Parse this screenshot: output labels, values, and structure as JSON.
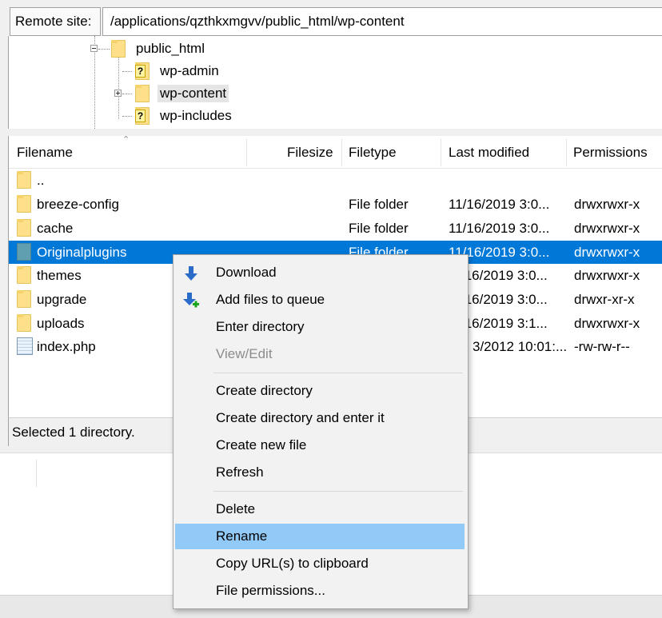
{
  "remote_site": {
    "label": "Remote site:",
    "path": "/applications/qzthkxmgvv/public_html/wp-content"
  },
  "tree": {
    "nodes": [
      {
        "label": "public_html",
        "icon": "folder-icon",
        "expander": "minus"
      },
      {
        "label": "wp-admin",
        "icon": "folder-question-icon"
      },
      {
        "label": "wp-content",
        "icon": "folder-icon",
        "expander": "plus",
        "highlighted": true
      },
      {
        "label": "wp-includes",
        "icon": "folder-question-icon"
      }
    ]
  },
  "file_list": {
    "columns": [
      "Filename",
      "Filesize",
      "Filetype",
      "Last modified",
      "Permissions"
    ],
    "rows": [
      {
        "name": "..",
        "size": "",
        "type": "",
        "modified": "",
        "perms": "",
        "icon": "folder-icon"
      },
      {
        "name": "breeze-config",
        "size": "",
        "type": "File folder",
        "modified": "11/16/2019 3:0...",
        "perms": "drwxrwxr-x",
        "icon": "folder-icon"
      },
      {
        "name": "cache",
        "size": "",
        "type": "File folder",
        "modified": "11/16/2019 3:0...",
        "perms": "drwxrwxr-x",
        "icon": "folder-icon"
      },
      {
        "name": "Originalplugins",
        "size": "",
        "type": "File folder",
        "modified": "11/16/2019 3:0...",
        "perms": "drwxrwxr-x",
        "icon": "folder-icon",
        "selected": true
      },
      {
        "name": "themes",
        "size": "",
        "type": "",
        "modified": "/16/2019 3:0...",
        "perms": "drwxrwxr-x",
        "icon": "folder-icon"
      },
      {
        "name": "upgrade",
        "size": "",
        "type": "",
        "modified": "/16/2019 3:0...",
        "perms": "drwxr-xr-x",
        "icon": "folder-icon"
      },
      {
        "name": "uploads",
        "size": "",
        "type": "",
        "modified": "/16/2019 3:1...",
        "perms": "drwxrwxr-x",
        "icon": "folder-icon"
      },
      {
        "name": "index.php",
        "size": "",
        "type": "",
        "modified": "3/2012 10:01:...",
        "perms": "-rw-rw-r--",
        "icon": "file-icon"
      }
    ]
  },
  "status": {
    "text": "Selected 1 directory."
  },
  "context_menu": {
    "items": [
      {
        "label": "Download",
        "icon": "download-icon",
        "enabled": true
      },
      {
        "label": "Add files to queue",
        "icon": "add-queue-icon",
        "enabled": true
      },
      {
        "label": "Enter directory",
        "enabled": true
      },
      {
        "label": "View/Edit",
        "enabled": false
      },
      {
        "label": "Create directory",
        "enabled": true
      },
      {
        "label": "Create directory and enter it",
        "enabled": true
      },
      {
        "label": "Create new file",
        "enabled": true
      },
      {
        "label": "Refresh",
        "enabled": true
      },
      {
        "label": "Delete",
        "enabled": true
      },
      {
        "label": "Rename",
        "enabled": true,
        "hovered": true
      },
      {
        "label": "Copy URL(s) to clipboard",
        "enabled": true
      },
      {
        "label": "File permissions...",
        "enabled": true
      }
    ]
  },
  "colors": {
    "selection": "#0078d7",
    "menu_hover": "#91c9f7",
    "folder": "#ffe08a",
    "disabled_text": "#8c8c8c"
  }
}
